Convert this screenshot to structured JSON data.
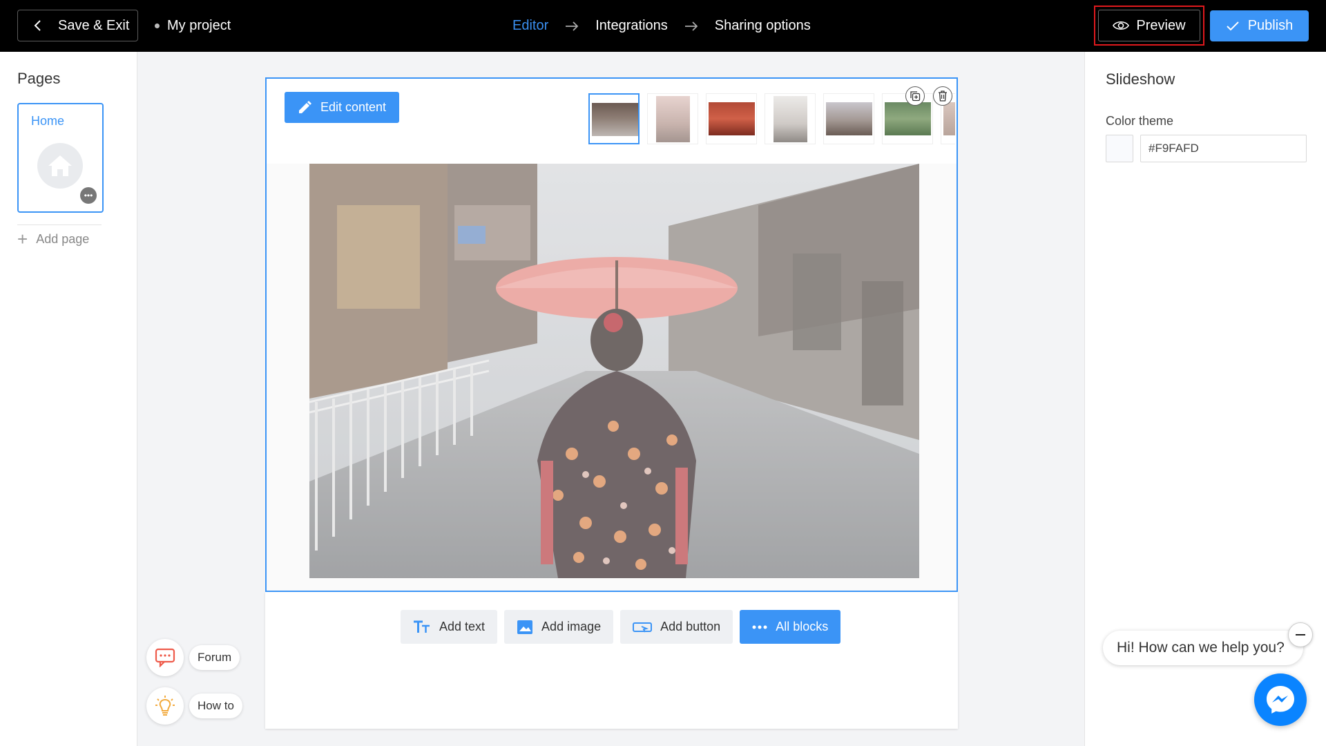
{
  "topbar": {
    "save_exit": "Save & Exit",
    "project_name": "My project",
    "steps": [
      "Editor",
      "Integrations",
      "Sharing options"
    ],
    "active_step": "Editor",
    "preview": "Preview",
    "publish": "Publish"
  },
  "pages": {
    "title": "Pages",
    "items": [
      {
        "label": "Home",
        "icon": "home-icon"
      }
    ],
    "add_page": "Add page"
  },
  "editor": {
    "edit_content": "Edit content",
    "thumbnail_count": 7,
    "active_thumbnail": 0,
    "add_buttons": [
      "Add text",
      "Add image",
      "Add button",
      "All blocks"
    ]
  },
  "help": {
    "forum": "Forum",
    "how_to": "How to"
  },
  "settings": {
    "title": "Slideshow",
    "color_theme_label": "Color theme",
    "color_theme_value": "#F9FAFD"
  },
  "chat": {
    "greeting": "Hi! How can we help you?"
  },
  "colors": {
    "accent": "#3b94f6",
    "topbar_bg": "#000000",
    "preview_highlight": "#e0191d",
    "messenger": "#0a84ff"
  }
}
